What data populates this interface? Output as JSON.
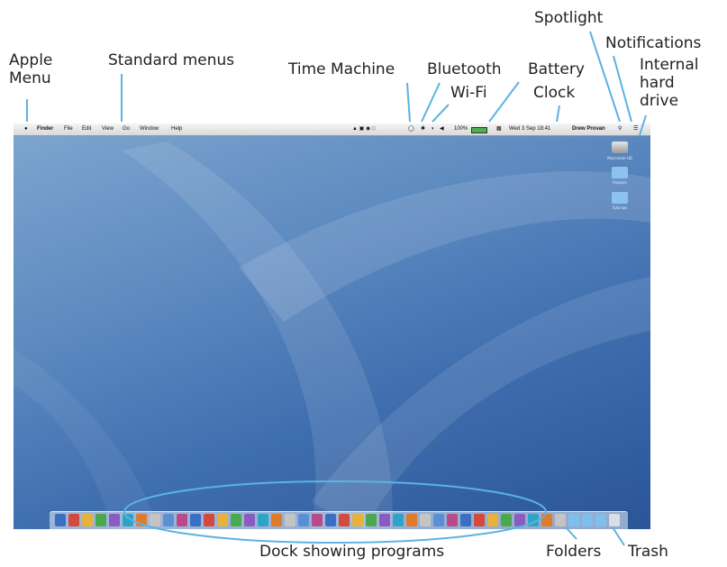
{
  "callouts": {
    "apple_menu": [
      "Apple",
      "Menu"
    ],
    "standard_menus": "Standard menus",
    "time_machine": "Time Machine",
    "bluetooth": "Bluetooth",
    "wifi": "Wi-Fi",
    "battery": "Battery",
    "clock": "Clock",
    "spotlight": "Spotlight",
    "notifications": "Notifications",
    "internal_hard_drive": [
      "Internal",
      "hard",
      "drive"
    ],
    "dock": "Dock showing programs",
    "folders": "Folders",
    "trash": "Trash"
  },
  "menubar": {
    "apple": "",
    "app_menu": "Finder",
    "items": [
      "File",
      "Edit",
      "View",
      "Go",
      "Window",
      "Help"
    ],
    "battery_percent": "100%",
    "clock": "Wed 3 Sep 18:41",
    "user": "Drew Provan"
  },
  "desktop_icons": [
    "Macintosh HD",
    "Projects",
    "Tutorials"
  ],
  "colors": {
    "wallpaper_light": "#7ea6cf",
    "wallpaper_dark": "#2a5597",
    "callout_line": "#5bb3e0"
  }
}
